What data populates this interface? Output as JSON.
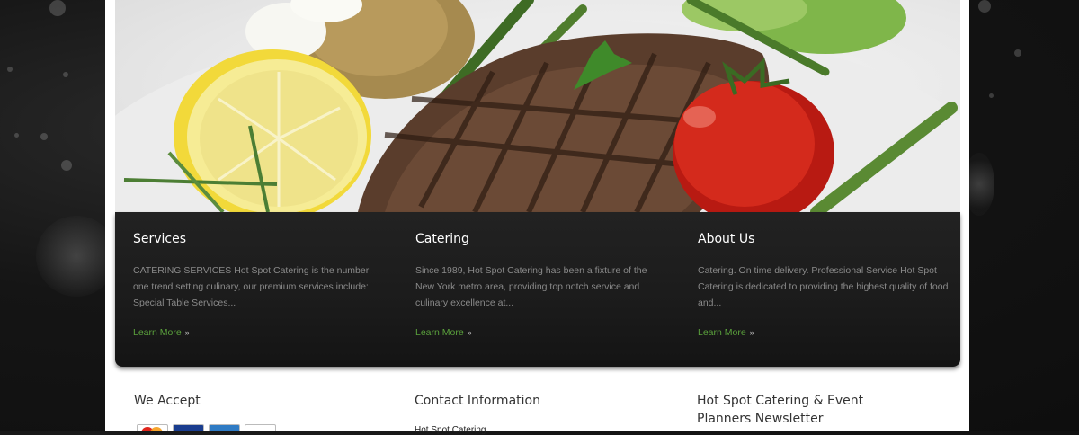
{
  "hero": {
    "alt_subject": "grilled-steak-plate"
  },
  "features": [
    {
      "title": "Services",
      "text": "CATERING SERVICES Hot Spot Catering is the number one trend setting culinary, our premium services include: Special Table Services...",
      "link": "Learn More"
    },
    {
      "title": "Catering",
      "text": "Since 1989, Hot Spot Catering has been a fixture of the New York metro area, providing top notch service and culinary excellence at...",
      "link": "Learn More"
    },
    {
      "title": "About Us",
      "text": "Catering.  On time delivery.  Professional Service Hot Spot Catering is dedicated to providing the highest quality of food and...",
      "link": "Learn More"
    }
  ],
  "footer": {
    "we_accept": "We Accept",
    "cards": [
      "mastercard-icon",
      "visa-icon",
      "amex-icon",
      "discover-icon"
    ],
    "contact_title": "Contact Information",
    "contact_name": "Hot Spot Catering",
    "newsletter_title_line1": "Hot Spot Catering & Event",
    "newsletter_title_line2": "Planners Newsletter"
  },
  "colors": {
    "accent_link": "#5aa03c",
    "panel_bg": "#1b1b1b",
    "page_bg": "#111111"
  }
}
